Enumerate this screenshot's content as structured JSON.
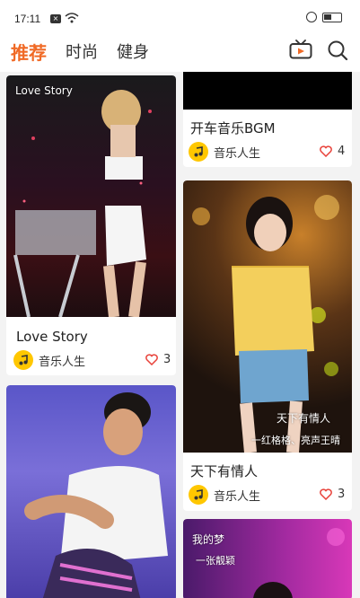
{
  "status": {
    "time": "17:11",
    "x_badge": "×"
  },
  "tabs": [
    {
      "label": "推荐",
      "active": true
    },
    {
      "label": "时尚",
      "active": false
    },
    {
      "label": "健身",
      "active": false
    }
  ],
  "cards": [
    {
      "title": "Love Story",
      "image_caption": "Love Story",
      "author": "音乐人生",
      "likes": "3"
    },
    {
      "title": "开车音乐BGM",
      "author": "音乐人生",
      "likes": "4"
    },
    {
      "title": "天下有情人",
      "image_caption_1": "天下有情人",
      "image_caption_2": "一红格格、亮声王晴",
      "author": "音乐人生",
      "likes": "3"
    },
    {
      "title": "",
      "author": "",
      "likes": ""
    },
    {
      "image_caption_1": "我的梦",
      "image_caption_2": "一张靓颖"
    }
  ],
  "colors": {
    "accent": "#f06a26",
    "heart": "#e8423a",
    "avatar": "#ffc700"
  },
  "icons": [
    "tv-icon",
    "search-icon",
    "heart-icon",
    "music-note-icon",
    "wifi-icon",
    "alarm-icon",
    "battery-icon"
  ]
}
